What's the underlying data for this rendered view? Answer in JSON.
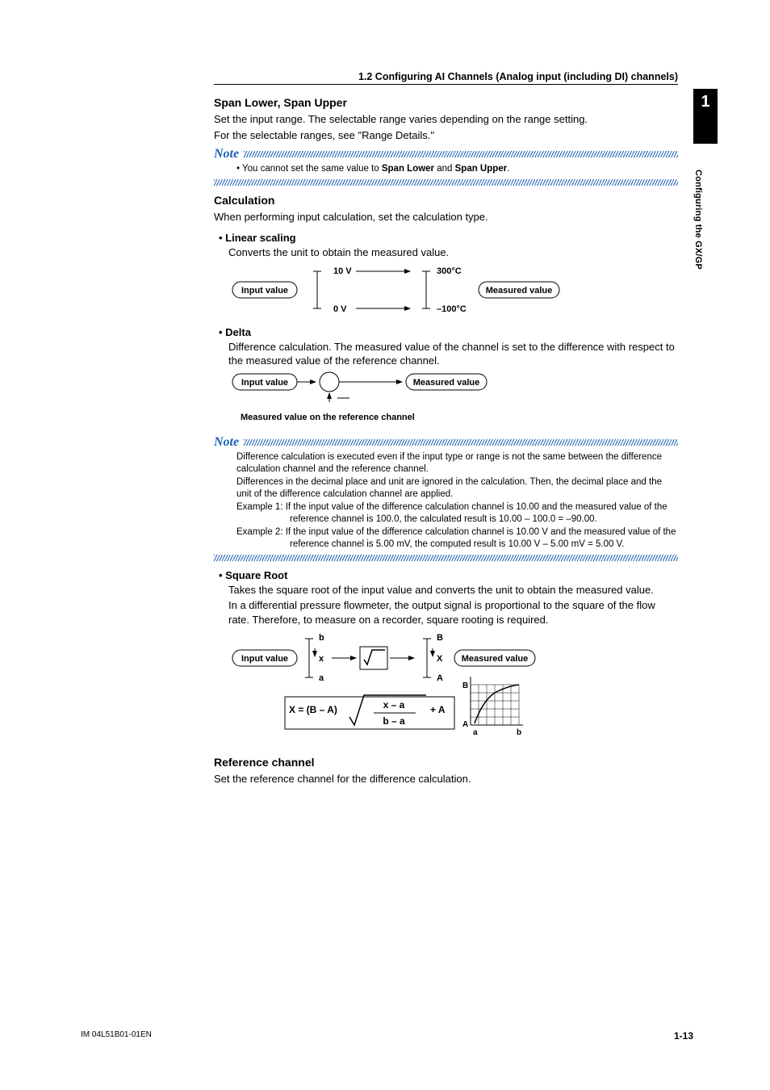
{
  "sideTab": {
    "chapterNum": "1",
    "chapterTitle": "Configuring the GX/GP"
  },
  "header": "1.2  Configuring AI Channels (Analog input (including DI) channels)",
  "span": {
    "title": "Span Lower, Span Upper",
    "p1": "Set the input range. The selectable range varies depending on the range setting.",
    "p2": "For the selectable ranges, see \"Range Details.\""
  },
  "note1": {
    "label": "Note",
    "line_prefix": "•   You cannot set the same value to ",
    "b1": "Span Lower",
    "mid": " and ",
    "b2": "Span Upper",
    "suffix": "."
  },
  "calc": {
    "title": "Calculation",
    "p1": "When performing input calculation, set the calculation type."
  },
  "linear": {
    "title": "Linear scaling",
    "p1": "Converts the unit to obtain the measured value.",
    "diagram": {
      "input": "Input value",
      "measured": "Measured value",
      "top1": "10 V",
      "bot1": "0 V",
      "top2": "300°C",
      "bot2": "–100°C"
    }
  },
  "delta": {
    "title": "Delta",
    "p1": "Difference calculation. The measured value of the channel is set to the difference with respect to the measured value of the reference channel.",
    "diagram": {
      "input": "Input value",
      "measured": "Measured value",
      "caption": "Measured value on the reference channel"
    }
  },
  "note2": {
    "label": "Note",
    "l1": "Difference calculation is executed even if the input type or range is not the same between the difference calculation channel and the reference channel.",
    "l2": "Differences in the decimal place and unit are ignored in the calculation. Then, the decimal place and the unit of the difference calculation channel are applied.",
    "l3a": "Example 1: If the input value of the difference calculation channel is 10.00 and the measured value of the reference channel is 100.0, the calculated result is 10.00 – 100.0 = –90.00.",
    "l4a": "Example 2: If the input value of the difference calculation channel is 10.00 V and the measured value of the reference channel is 5.00 mV, the computed result is 10.00 V – 5.00 mV = 5.00 V."
  },
  "sqrt": {
    "title": "Square Root",
    "p1": "Takes the square root of the input value and converts the unit to obtain the measured value.",
    "p2": "In a differential pressure flowmeter, the output signal is proportional to the square of the flow rate. Therefore, to measure on a recorder, square rooting is required.",
    "diagram": {
      "input": "Input value",
      "measured": "Measured value",
      "a": "a",
      "b": "b",
      "x": "x",
      "A": "A",
      "B": "B",
      "X": "X",
      "formula_pre": "X = (B – A)",
      "frac_top": "x – a",
      "frac_bot": "b – a",
      "formula_post": "+ A"
    }
  },
  "ref": {
    "title": "Reference channel",
    "p1": "Set the reference channel for the difference calculation."
  },
  "footer": {
    "doc": "IM 04L51B01-01EN",
    "page": "1-13"
  }
}
